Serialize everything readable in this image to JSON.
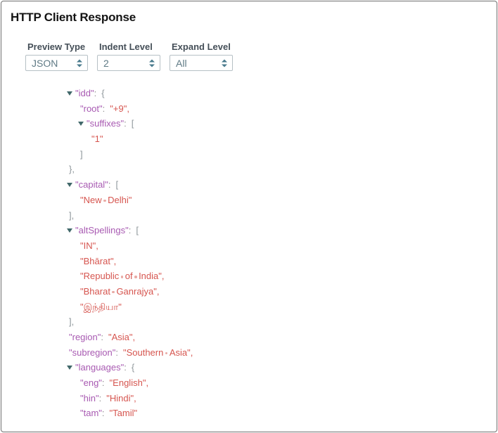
{
  "panel": {
    "title": "HTTP Client Response"
  },
  "controls": [
    {
      "label": "Preview Type",
      "value": "JSON"
    },
    {
      "label": "Indent Level",
      "value": "2"
    },
    {
      "label": "Expand Level",
      "value": "All"
    }
  ],
  "tree": {
    "lines": [
      {
        "level": 0,
        "expand": true,
        "key": "idd",
        "open": "{"
      },
      {
        "level": 1,
        "key": "root",
        "value": "+9",
        "comma": true
      },
      {
        "level": 1,
        "expand": true,
        "key": "suffixes",
        "open": "["
      },
      {
        "level": 2,
        "value": "1"
      },
      {
        "level": 1,
        "close": "]"
      },
      {
        "level": 0,
        "close": "}",
        "comma": true
      },
      {
        "level": 0,
        "expand": true,
        "key": "capital",
        "open": "["
      },
      {
        "level": 1,
        "value": "New Delhi"
      },
      {
        "level": 0,
        "close": "]",
        "comma": true
      },
      {
        "level": 0,
        "expand": true,
        "key": "altSpellings",
        "open": "["
      },
      {
        "level": 1,
        "value": "IN",
        "comma": true
      },
      {
        "level": 1,
        "value": "Bhārat",
        "comma": true
      },
      {
        "level": 1,
        "value": "Republic of India",
        "comma": true
      },
      {
        "level": 1,
        "value": "Bharat Ganrajya",
        "comma": true
      },
      {
        "level": 1,
        "value": "இந்தியா"
      },
      {
        "level": 0,
        "close": "]",
        "comma": true
      },
      {
        "level": 0,
        "key": "region",
        "value": "Asia",
        "comma": true
      },
      {
        "level": 0,
        "key": "subregion",
        "value": "Southern Asia",
        "comma": true
      },
      {
        "level": 0,
        "expand": true,
        "key": "languages",
        "open": "{"
      },
      {
        "level": 1,
        "key": "eng",
        "value": "English",
        "comma": true
      },
      {
        "level": 1,
        "key": "hin",
        "value": "Hindi",
        "comma": true
      },
      {
        "level": 1,
        "key": "tam",
        "value": "Tamil"
      }
    ]
  },
  "colors": {
    "key": "#a85ab2",
    "string": "#d6554f",
    "bracket": "#8f979b",
    "toggle": "#41686a",
    "space_dot": "#e9aba5",
    "select_text": "#5f7a85",
    "spinner": "#4a7b8d"
  }
}
